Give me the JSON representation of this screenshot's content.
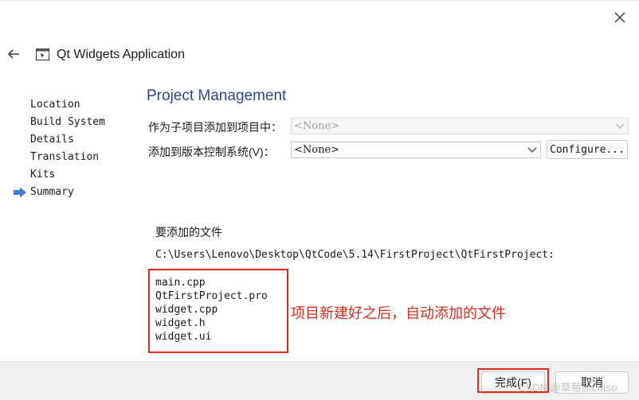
{
  "window": {
    "title": "Qt Widgets Application"
  },
  "icons": {
    "close": "close-icon",
    "back": "back-arrow-icon",
    "app": "qt-app-icon",
    "step_indicator": "arrow-right-icon",
    "dropdown": "chevron-down-icon"
  },
  "steps": [
    {
      "label": "Location"
    },
    {
      "label": "Build System"
    },
    {
      "label": "Details"
    },
    {
      "label": "Translation"
    },
    {
      "label": "Kits"
    },
    {
      "label": "Summary",
      "current": true
    }
  ],
  "page": {
    "heading": "Project Management",
    "subproject_label": "作为子项目添加到项目中：",
    "subproject_value": "<None>",
    "vcs_label": "添加到版本控制系统(V)：",
    "vcs_value": "<None>",
    "configure_label": "Configure...",
    "files_heading": "要添加的文件",
    "files_path": "C:\\Users\\Lenovo\\Desktop\\QtCode\\5.14\\FirstProject\\QtFirstProject:",
    "files": [
      "main.cpp",
      "QtFirstProject.pro",
      "widget.cpp",
      "widget.h",
      "widget.ui"
    ]
  },
  "annotation": {
    "text": "项目新建好之后，自动添加的文件",
    "color": "#e02a1b"
  },
  "footer": {
    "finish_label": "完成(F)",
    "cancel_label": "取消"
  },
  "watermark": "CSDN @草莓熊Lotso",
  "colors": {
    "heading": "#2d4a8f",
    "highlight": "#e02a1b",
    "footer_bg": "#f0f0f0"
  }
}
